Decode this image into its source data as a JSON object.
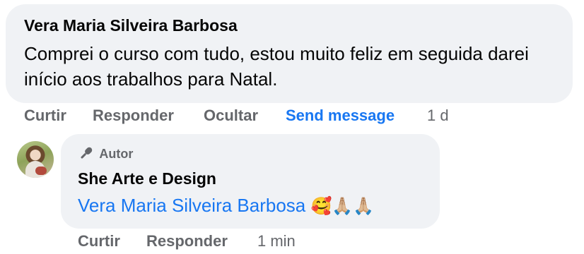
{
  "comment": {
    "author": "Vera Maria Silveira Barbosa",
    "text": "Comprei o curso com tudo, estou muito feliz em seguida darei início aos trabalhos para Natal.",
    "actions": {
      "like": "Curtir",
      "reply": "Responder",
      "hide": "Ocultar",
      "send_message": "Send message",
      "time": "1 d"
    }
  },
  "reply": {
    "badge": "Autor",
    "badge_icon": "microphone-icon",
    "author": "She Arte e Design",
    "mention": "Vera Maria Silveira Barbosa",
    "emojis": "🥰🙏🏼🙏🏼",
    "actions": {
      "like": "Curtir",
      "reply": "Responder",
      "time": "1 min"
    }
  },
  "colors": {
    "bubble": "#f0f2f5",
    "link": "#1877f2",
    "muted": "#65676b",
    "text": "#050505"
  }
}
